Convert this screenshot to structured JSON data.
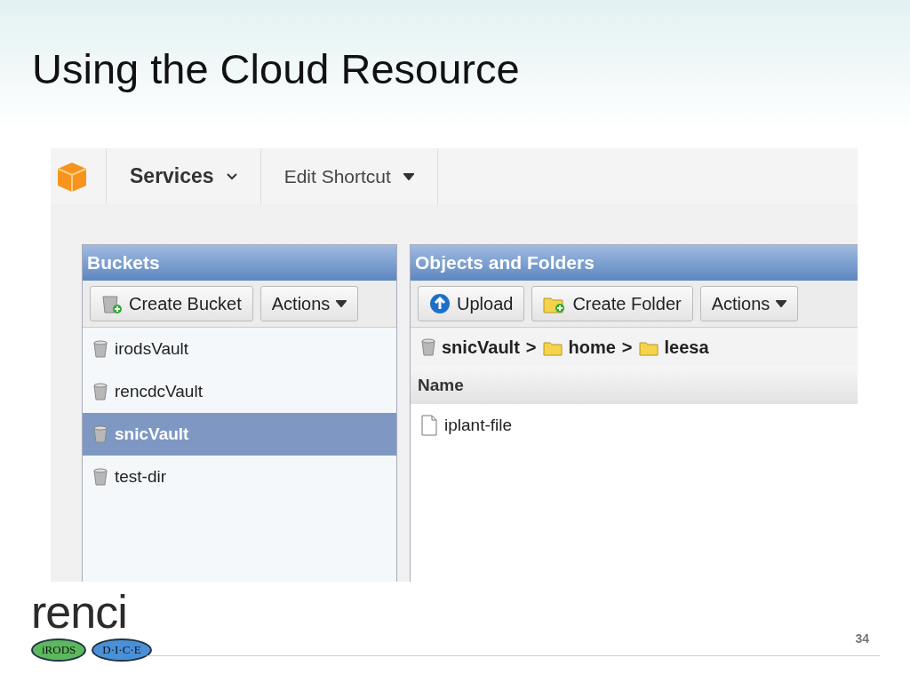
{
  "slide": {
    "title": "Using the Cloud Resource",
    "page_number": "34"
  },
  "nav": {
    "items": [
      {
        "label": "Services",
        "kind": "bold"
      },
      {
        "label": "Edit Shortcut",
        "kind": "plain"
      }
    ]
  },
  "buckets_panel": {
    "title": "Buckets",
    "buttons": [
      {
        "label": "Create Bucket",
        "kind": "create-bucket"
      },
      {
        "label": "Actions",
        "kind": "menu"
      }
    ],
    "items": [
      {
        "label": "irodsVault",
        "selected": false
      },
      {
        "label": "rencdcVault",
        "selected": false
      },
      {
        "label": "snicVault",
        "selected": true
      },
      {
        "label": "test-dir",
        "selected": false
      }
    ]
  },
  "objects_panel": {
    "title": "Objects and Folders",
    "buttons": [
      {
        "label": "Upload",
        "kind": "upload"
      },
      {
        "label": "Create Folder",
        "kind": "create-folder"
      },
      {
        "label": "Actions",
        "kind": "menu"
      }
    ],
    "breadcrumb": [
      {
        "kind": "bucket",
        "label": "snicVault"
      },
      {
        "kind": "separator",
        "label": ">"
      },
      {
        "kind": "folder",
        "label": "home"
      },
      {
        "kind": "separator",
        "label": ">"
      },
      {
        "kind": "folder",
        "label": "leesa"
      }
    ],
    "columns": [
      "Name"
    ],
    "rows": [
      {
        "name": "iplant-file"
      }
    ]
  },
  "logo": {
    "wordmark": "renci",
    "badges": [
      {
        "label": "iRODS",
        "color": "#5cb85c"
      },
      {
        "label": "D·I·C·E",
        "color": "#4a90d9"
      }
    ]
  }
}
